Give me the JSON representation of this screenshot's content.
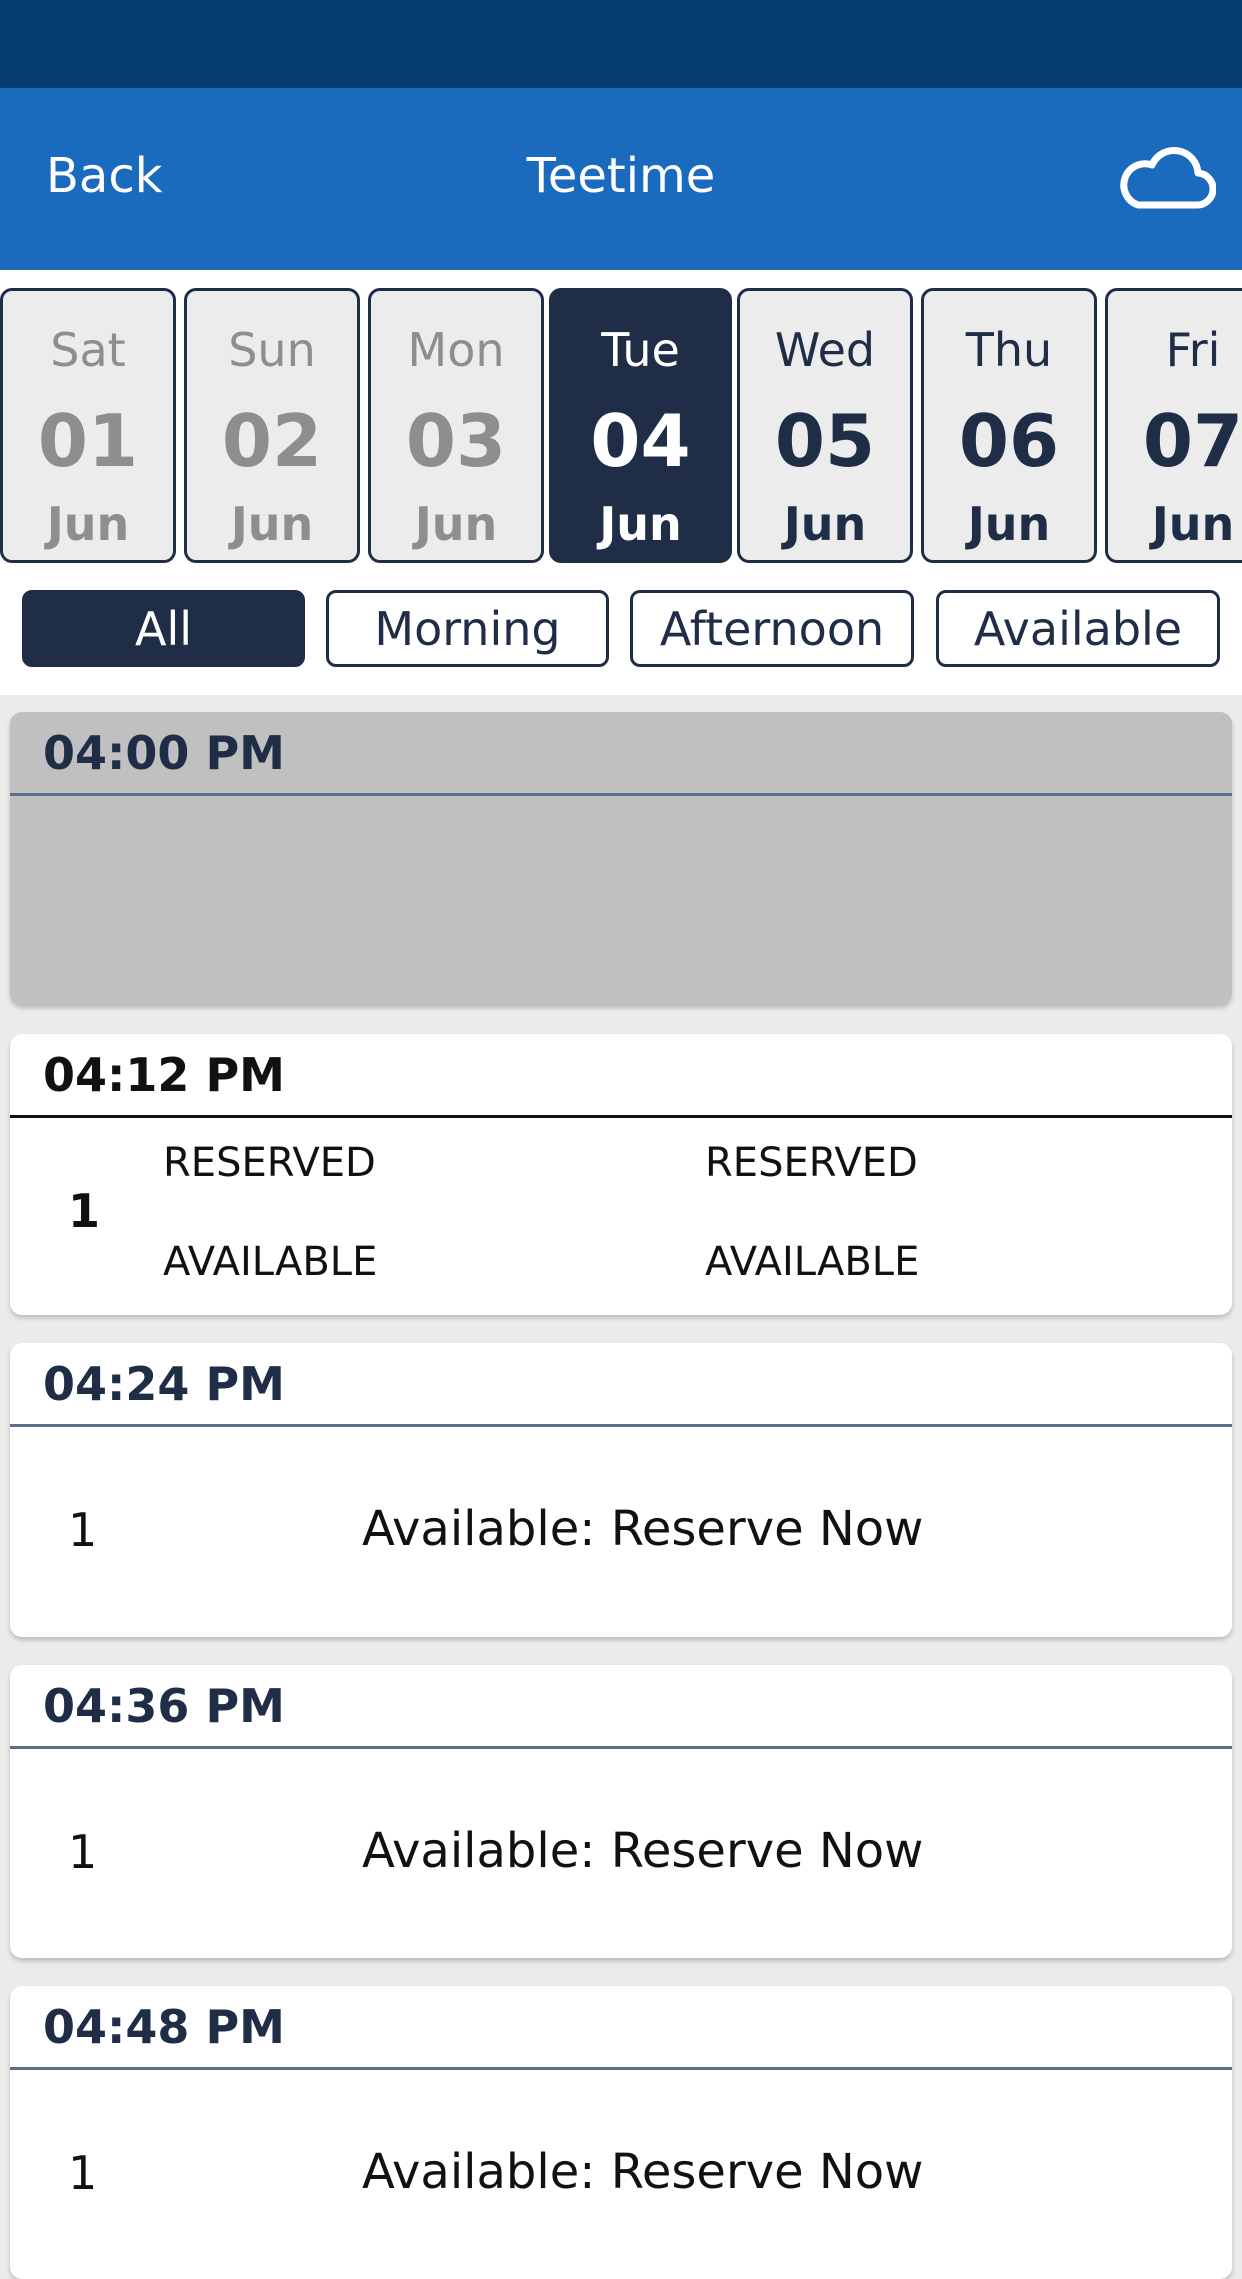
{
  "header": {
    "back_label": "Back",
    "title": "Teetime",
    "weather_icon": "cloud-icon"
  },
  "dates": [
    {
      "day": "Sat",
      "date": "01",
      "month": "Jun",
      "state": "past"
    },
    {
      "day": "Sun",
      "date": "02",
      "month": "Jun",
      "state": "past"
    },
    {
      "day": "Mon",
      "date": "03",
      "month": "Jun",
      "state": "past"
    },
    {
      "day": "Tue",
      "date": "04",
      "month": "Jun",
      "state": "selected"
    },
    {
      "day": "Wed",
      "date": "05",
      "month": "Jun",
      "state": "future"
    },
    {
      "day": "Thu",
      "date": "06",
      "month": "Jun",
      "state": "future"
    },
    {
      "day": "Fri",
      "date": "07",
      "month": "Jun",
      "state": "future"
    }
  ],
  "filters": [
    {
      "label": "All",
      "active": true
    },
    {
      "label": "Morning"
    },
    {
      "label": "Afternoon"
    },
    {
      "label": "Available"
    }
  ],
  "teetimes": [
    {
      "time": "04:00 PM"
    },
    {
      "time": "04:12 PM",
      "hole": "1",
      "slots": [
        "RESERVED",
        "RESERVED",
        "AVAILABLE",
        "AVAILABLE"
      ]
    },
    {
      "time": "04:24 PM",
      "hole": "1",
      "status": "Available: Reserve Now"
    },
    {
      "time": "04:36 PM",
      "hole": "1",
      "status": "Available: Reserve Now"
    },
    {
      "time": "04:48 PM",
      "hole": "1",
      "status": "Available: Reserve Now"
    }
  ],
  "colors": {
    "status_bar": "#053d72",
    "header": "#1a6abd",
    "navy": "#1f2d47"
  }
}
